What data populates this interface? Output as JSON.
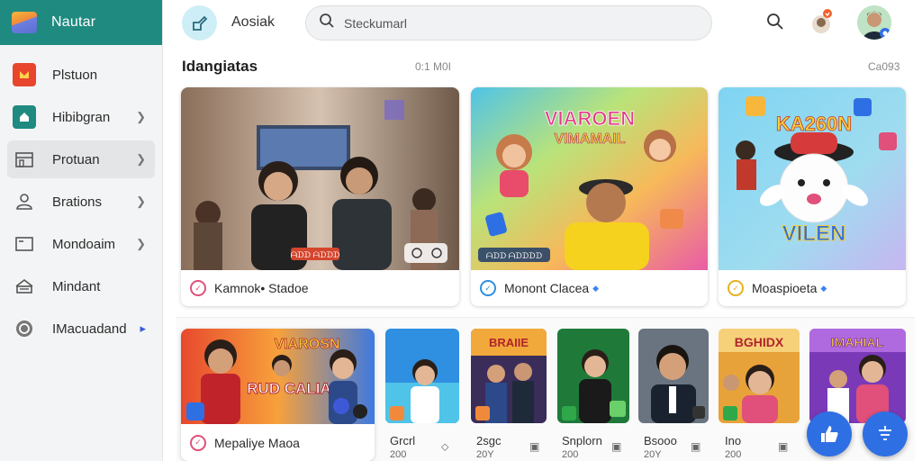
{
  "brand": {
    "name": "Nautar"
  },
  "sidebar": {
    "items": [
      {
        "label": "Plstuon",
        "icon": "fire-icon",
        "active": false,
        "chevron": false
      },
      {
        "label": "Hibibgran",
        "icon": "home-icon",
        "active": false,
        "chevron": true
      },
      {
        "label": "Protuan",
        "icon": "store-icon",
        "active": true,
        "chevron": true
      },
      {
        "label": "Brations",
        "icon": "user-icon",
        "active": false,
        "chevron": true
      },
      {
        "label": "Mondoaim",
        "icon": "window-icon",
        "active": false,
        "chevron": true
      },
      {
        "label": "Mindant",
        "icon": "inbox-icon",
        "active": false,
        "chevron": false
      },
      {
        "label": "IMacuadand",
        "icon": "badge-icon",
        "active": false,
        "chevron": true
      }
    ]
  },
  "header": {
    "title": "Aosiak",
    "search_placeholder": "Steckumarl"
  },
  "section": {
    "title": "Idangiatas",
    "meta": "0:1 M0I",
    "right": "Ca093"
  },
  "cards": [
    {
      "label": "Kamnok• Stadoe",
      "dot_color": "#e0507a",
      "diamond": false,
      "overlay_tag": "ᗩᗪᗪ ᗩᗪᗪᗪ"
    },
    {
      "label": "Monont Clacea",
      "dot_color": "#2f8fe0",
      "diamond": true,
      "overlay_tag": "ᗩᗪᗪ ᗩᗪᗪᗪᗪ"
    },
    {
      "label": "Moaspioeta",
      "dot_color": "#e8b21f",
      "diamond": true,
      "banner_top": "KA260N",
      "banner_bottom": "VILEN"
    }
  ],
  "card2_banner": {
    "top": "VIAROEN",
    "bottom": "VIMAMAIL"
  },
  "row2": {
    "feature": {
      "label": "Mepaliye Maoa",
      "banner_top": "VIAROSN",
      "banner_mid": "RUD CALIA"
    },
    "tiles": [
      {
        "cap": "Grcrl",
        "sub": "200"
      },
      {
        "cap": "2sgc",
        "sub": "20Y"
      },
      {
        "cap": "Snplorn",
        "sub": "200"
      },
      {
        "cap": "Bsooo",
        "sub": "20Y"
      },
      {
        "cap": "Ino",
        "sub": "200"
      }
    ],
    "tile_banners": [
      "BRAIIE",
      "",
      "",
      "BGHIDX",
      "IMAHIAL"
    ]
  },
  "colors": {
    "brand": "#1f8a80",
    "accent": "#2f6fe4"
  }
}
